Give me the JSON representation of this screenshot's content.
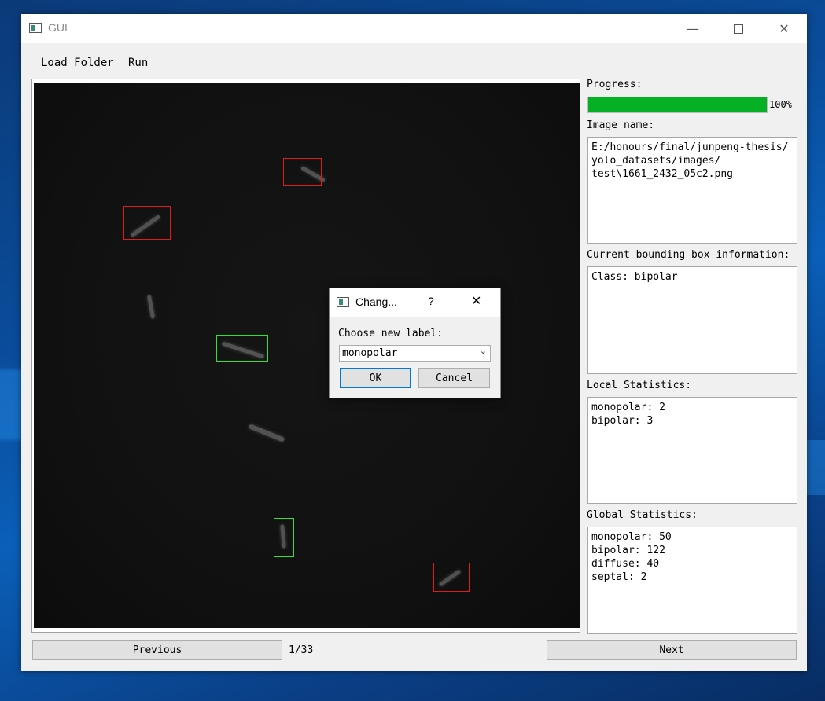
{
  "window": {
    "title": "GUI",
    "minimize_icon": "minimize-icon",
    "maximize_icon": "maximize-icon",
    "close_icon": "close-icon"
  },
  "menu": {
    "items": [
      "Load Folder",
      "Run"
    ]
  },
  "progress": {
    "label": "Progress:",
    "value": 1.0,
    "text": "100%",
    "color": "#06b025"
  },
  "image_name": {
    "label": "Image name:",
    "value": "E:/honours/final/junpeng-thesis/\nyolo_datasets/images/\ntest\\1661_2432_05c2.png"
  },
  "bbox_info": {
    "label": "Current bounding box information:",
    "value": "Class: bipolar"
  },
  "local_stats": {
    "label": "Local Statistics:",
    "value": "monopolar: 2\nbipolar: 3"
  },
  "global_stats": {
    "label": "Global Statistics:",
    "value": "monopolar: 50\nbipolar: 122\ndiffuse: 40\nseptal: 2"
  },
  "nav": {
    "previous": "Previous",
    "page": "1/33",
    "next": "Next"
  },
  "colors": {
    "bbox_bipolar": "#e01b1b",
    "bbox_monopolar": "#33e033"
  },
  "dialog": {
    "title": "Chang...",
    "help": "?",
    "close": "✕",
    "prompt": "Choose new label:",
    "selected": "monopolar",
    "ok": "OK",
    "cancel": "Cancel"
  }
}
